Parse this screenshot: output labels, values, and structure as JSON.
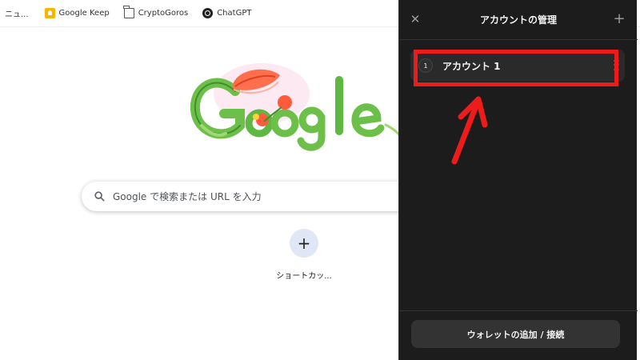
{
  "bookmarks": [
    {
      "label": "ニュ...",
      "icon": "none"
    },
    {
      "label": "Google Keep",
      "icon": "keep-icon"
    },
    {
      "label": "CryptoGoros",
      "icon": "folder-icon"
    },
    {
      "label": "ChatGPT",
      "icon": "chatgpt-icon"
    }
  ],
  "search": {
    "placeholder": "Google で検索または URL を入力",
    "icon": "search-icon"
  },
  "shortcut": {
    "label": "ショートカッ...",
    "icon": "plus-icon"
  },
  "panel": {
    "title": "アカウントの管理",
    "close_icon": "close-icon",
    "add_icon": "plus-icon",
    "accounts": [
      {
        "index": "1",
        "name": "アカウント 1"
      }
    ],
    "footer_button": "ウォレットの追加 / 接続"
  },
  "colors": {
    "panel_bg": "#1c1c1c",
    "row_bg": "#2a2a2a",
    "highlight": "#ee1b1b",
    "button_bg": "#333333"
  }
}
